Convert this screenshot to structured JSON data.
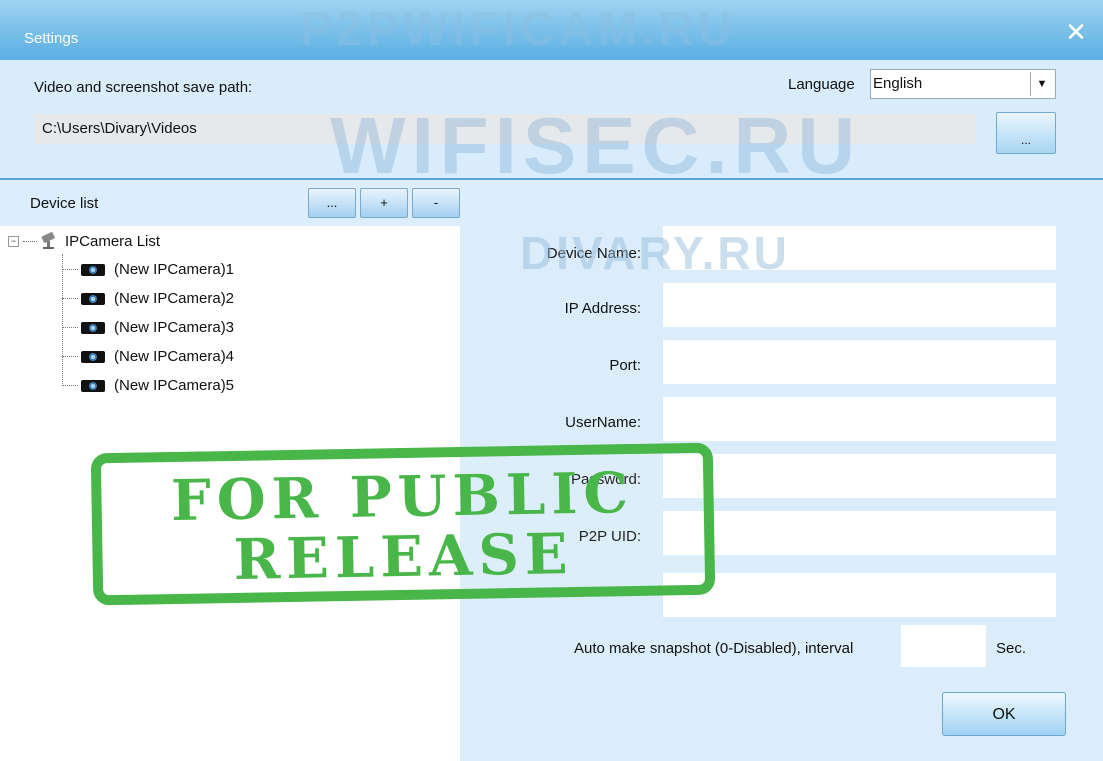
{
  "window": {
    "title": "Settings",
    "close_glyph": "✕"
  },
  "top": {
    "save_path_label": "Video and screenshot save path:",
    "save_path_value": "C:\\Users\\Divary\\Videos",
    "browse_label": "...",
    "language_label": "Language",
    "language_value": "English",
    "language_arrow": "▼"
  },
  "device_list": {
    "label": "Device list",
    "buttons": {
      "more": "...",
      "add": "+",
      "remove": "-"
    },
    "tree": {
      "toggle": "−",
      "root_label": "IPCamera List",
      "items": [
        "(New IPCamera)1",
        "(New IPCamera)2",
        "(New IPCamera)3",
        "(New IPCamera)4",
        "(New IPCamera)5"
      ]
    }
  },
  "form": {
    "device_name_label": "Device Name:",
    "ip_label": "IP Address:",
    "port_label": "Port:",
    "username_label": "UserName:",
    "password_label": "Password:",
    "uid_label": "P2P UID:",
    "snapshot_label": "Auto make snapshot (0-Disabled), interval",
    "snapshot_unit": "Sec.",
    "ok_label": "OK"
  },
  "watermarks": {
    "top": "P2PWIFICAM.RU",
    "middle": "WIFISEC.RU",
    "low": "DIVARY.RU",
    "stamp_line1": "FOR PUBLIC",
    "stamp_line2": "RELEASE"
  },
  "colors": {
    "titlebar": "#7ec2ea",
    "panel": "#dbedfb",
    "stamp": "#48b648"
  }
}
